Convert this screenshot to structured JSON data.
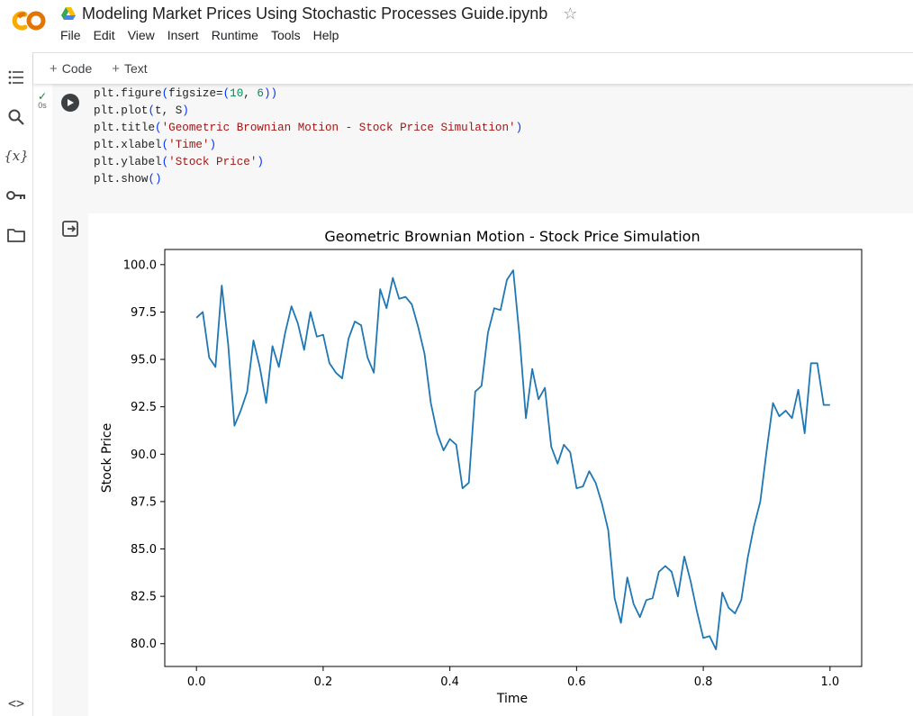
{
  "header": {
    "logo_text": "CO",
    "doc_title": "Modeling Market Prices Using Stochastic Processes Guide.ipynb",
    "menu": [
      "File",
      "Edit",
      "View",
      "Insert",
      "Runtime",
      "Tools",
      "Help"
    ]
  },
  "rail": {
    "icons": [
      "toc-icon",
      "search-icon",
      "variables-icon",
      "secrets-key-icon",
      "folder-icon",
      "code-snippets-icon"
    ]
  },
  "toolbar": {
    "code_label": "Code",
    "text_label": "Text"
  },
  "cell": {
    "exec_time": "0s",
    "code_lines": [
      "plt.figure(figsize=(10, 6))",
      "plt.plot(t, S)",
      "plt.title('Geometric Brownian Motion - Stock Price Simulation')",
      "plt.xlabel('Time')",
      "plt.ylabel('Stock Price')",
      "plt.show()"
    ]
  },
  "colors": {
    "line": "#1f77b4",
    "brand_orange": "#f9ab00",
    "brand_orange_dark": "#e37400"
  },
  "chart_data": {
    "type": "line",
    "title": "Geometric Brownian Motion - Stock Price Simulation",
    "xlabel": "Time",
    "ylabel": "Stock Price",
    "xlim": [
      -0.05,
      1.05
    ],
    "ylim": [
      78.8,
      100.8
    ],
    "xticks": [
      0.0,
      0.2,
      0.4,
      0.6,
      0.8,
      1.0
    ],
    "xtick_labels": [
      "0.0",
      "0.2",
      "0.4",
      "0.6",
      "0.8",
      "1.0"
    ],
    "yticks": [
      80.0,
      82.5,
      85.0,
      87.5,
      90.0,
      92.5,
      95.0,
      97.5,
      100.0
    ],
    "ytick_labels": [
      "80.0",
      "82.5",
      "85.0",
      "87.5",
      "90.0",
      "92.5",
      "95.0",
      "97.5",
      "100.0"
    ],
    "grid": false,
    "x": [
      0.0,
      0.01,
      0.02,
      0.03,
      0.04,
      0.05,
      0.06,
      0.07,
      0.08,
      0.09,
      0.1,
      0.11,
      0.12,
      0.13,
      0.14,
      0.15,
      0.16,
      0.17,
      0.18,
      0.19,
      0.2,
      0.21,
      0.22,
      0.23,
      0.24,
      0.25,
      0.26,
      0.27,
      0.28,
      0.29,
      0.3,
      0.31,
      0.32,
      0.33,
      0.34,
      0.35,
      0.36,
      0.37,
      0.38,
      0.39,
      0.4,
      0.41,
      0.42,
      0.43,
      0.44,
      0.45,
      0.46,
      0.47,
      0.48,
      0.49,
      0.5,
      0.51,
      0.52,
      0.53,
      0.54,
      0.55,
      0.56,
      0.57,
      0.58,
      0.59,
      0.6,
      0.61,
      0.62,
      0.63,
      0.64,
      0.65,
      0.66,
      0.67,
      0.68,
      0.69,
      0.7,
      0.71,
      0.72,
      0.73,
      0.74,
      0.75,
      0.76,
      0.77,
      0.78,
      0.79,
      0.8,
      0.81,
      0.82,
      0.83,
      0.84,
      0.85,
      0.86,
      0.87,
      0.88,
      0.89,
      0.9,
      0.91,
      0.92,
      0.93,
      0.94,
      0.95,
      0.96,
      0.97,
      0.98,
      0.99,
      1.0
    ],
    "y": [
      97.2,
      97.5,
      95.1,
      94.6,
      98.9,
      95.8,
      91.5,
      92.3,
      93.3,
      96.0,
      94.6,
      92.7,
      95.7,
      94.6,
      96.4,
      97.8,
      96.9,
      95.5,
      97.5,
      96.2,
      96.3,
      94.8,
      94.3,
      94.0,
      96.1,
      97.0,
      96.8,
      95.1,
      94.3,
      98.7,
      97.7,
      99.3,
      98.2,
      98.3,
      97.9,
      96.7,
      95.3,
      92.7,
      91.1,
      90.2,
      90.8,
      90.5,
      88.2,
      88.5,
      93.3,
      93.6,
      96.4,
      97.7,
      97.6,
      99.2,
      99.7,
      96.2,
      91.9,
      94.5,
      92.9,
      93.5,
      90.4,
      89.5,
      90.5,
      90.1,
      88.2,
      88.3,
      89.1,
      88.5,
      87.4,
      86.0,
      82.4,
      81.1,
      83.5,
      82.1,
      81.4,
      82.3,
      82.4,
      83.8,
      84.1,
      83.8,
      82.5,
      84.6,
      83.3,
      81.7,
      80.3,
      80.4,
      79.7,
      82.7,
      81.9,
      81.6,
      82.3,
      84.5,
      86.2,
      87.5,
      90.2,
      92.7,
      92.0,
      92.3,
      91.9,
      93.4,
      91.1,
      94.8,
      94.8,
      92.6,
      92.6
    ]
  }
}
